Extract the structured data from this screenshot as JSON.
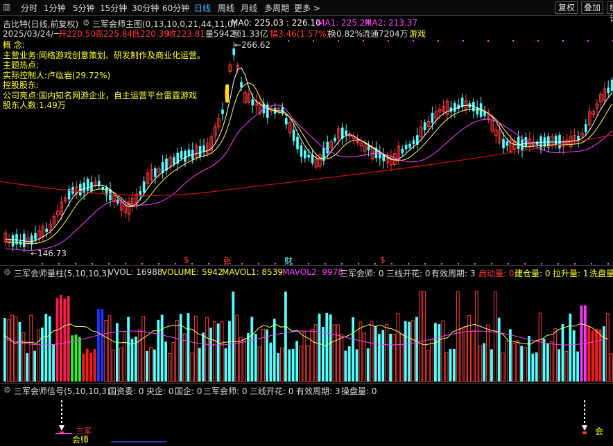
{
  "toolbar": {
    "tabs": [
      "分时",
      "1分钟",
      "5分钟",
      "15分钟",
      "30分钟",
      "60分钟",
      "日线",
      "周线",
      "月线",
      "多周期",
      "更多 >"
    ],
    "active_tab": "日线",
    "buttons": [
      "复权",
      "叠加",
      "统计"
    ]
  },
  "header": {
    "stock": "吉比特(日线,前复权)",
    "indicator": "三军会师主图(0,13,10,0,21,44,11,0)",
    "ma0": "MA0: 225.03 : 226.10",
    "ma1": "MA1: 225.24",
    "ma2": "MA2: 213.37",
    "date": "2025/03/24/一",
    "open": "开220.50",
    "high": "高225.84",
    "low": "低220.39",
    "close": "收223.81",
    "volume": "量5942",
    "amount": "额1.33亿",
    "change": "幅3.46(1.57%)",
    "turnover": "换0.82%",
    "float": "流通7204万",
    "sector": "游戏"
  },
  "overlay_text": [
    "概    念:",
    "主营业务:网络游戏创意策划、研发制作及商业化运营。",
    "主题热点:",
    "实际控制人:卢竑岩(29.72%)",
    "控股股东:",
    "公司亮点:国内知名网游企业，自主运营平台雷霆游戏",
    "股东人数:1.49万"
  ],
  "price_labels": {
    "high": "266.62",
    "low": "146.73"
  },
  "event_markers": [
    "$",
    "张",
    "财",
    "$"
  ],
  "volume_panel": {
    "title": "三军会师量柱(5,10,10,3)",
    "vvol": "VVOL: 16988",
    "volume": "VOLUME: 5942",
    "mavol1": "MAVOL1: 8539",
    "mavol2": "MAVOL2: 9978",
    "sanjun": "三军会师: 0",
    "sanxian": "三线开花: 0",
    "period": "有效周期: 3",
    "qidong": "启动量: 0",
    "jiancang": "建仓量: 0",
    "lasheng": "拉升量: 1",
    "xipan": "洗盘量"
  },
  "signal_panel": {
    "title": "三军会师信号(5,10,10,3)",
    "guozi": "国资委: 0",
    "yangqi": "央企: 0",
    "guoqi": "国企: 0",
    "sanjun": "三军会师: 0",
    "sanxian": "三线开花: 0",
    "period": "有效周期: 3",
    "caopan": "操盘量: 0",
    "marker_main": "会师",
    "marker_sub": "三军",
    "marker_right": "会"
  },
  "colors": {
    "up": "#ff3b3b",
    "down": "#54ffff",
    "ma_white": "#ffffff",
    "ma_yellow": "#ffff66",
    "ma_magenta": "#ff44ff",
    "ma_red": "#d01010",
    "accent": "#3db8ff"
  }
}
